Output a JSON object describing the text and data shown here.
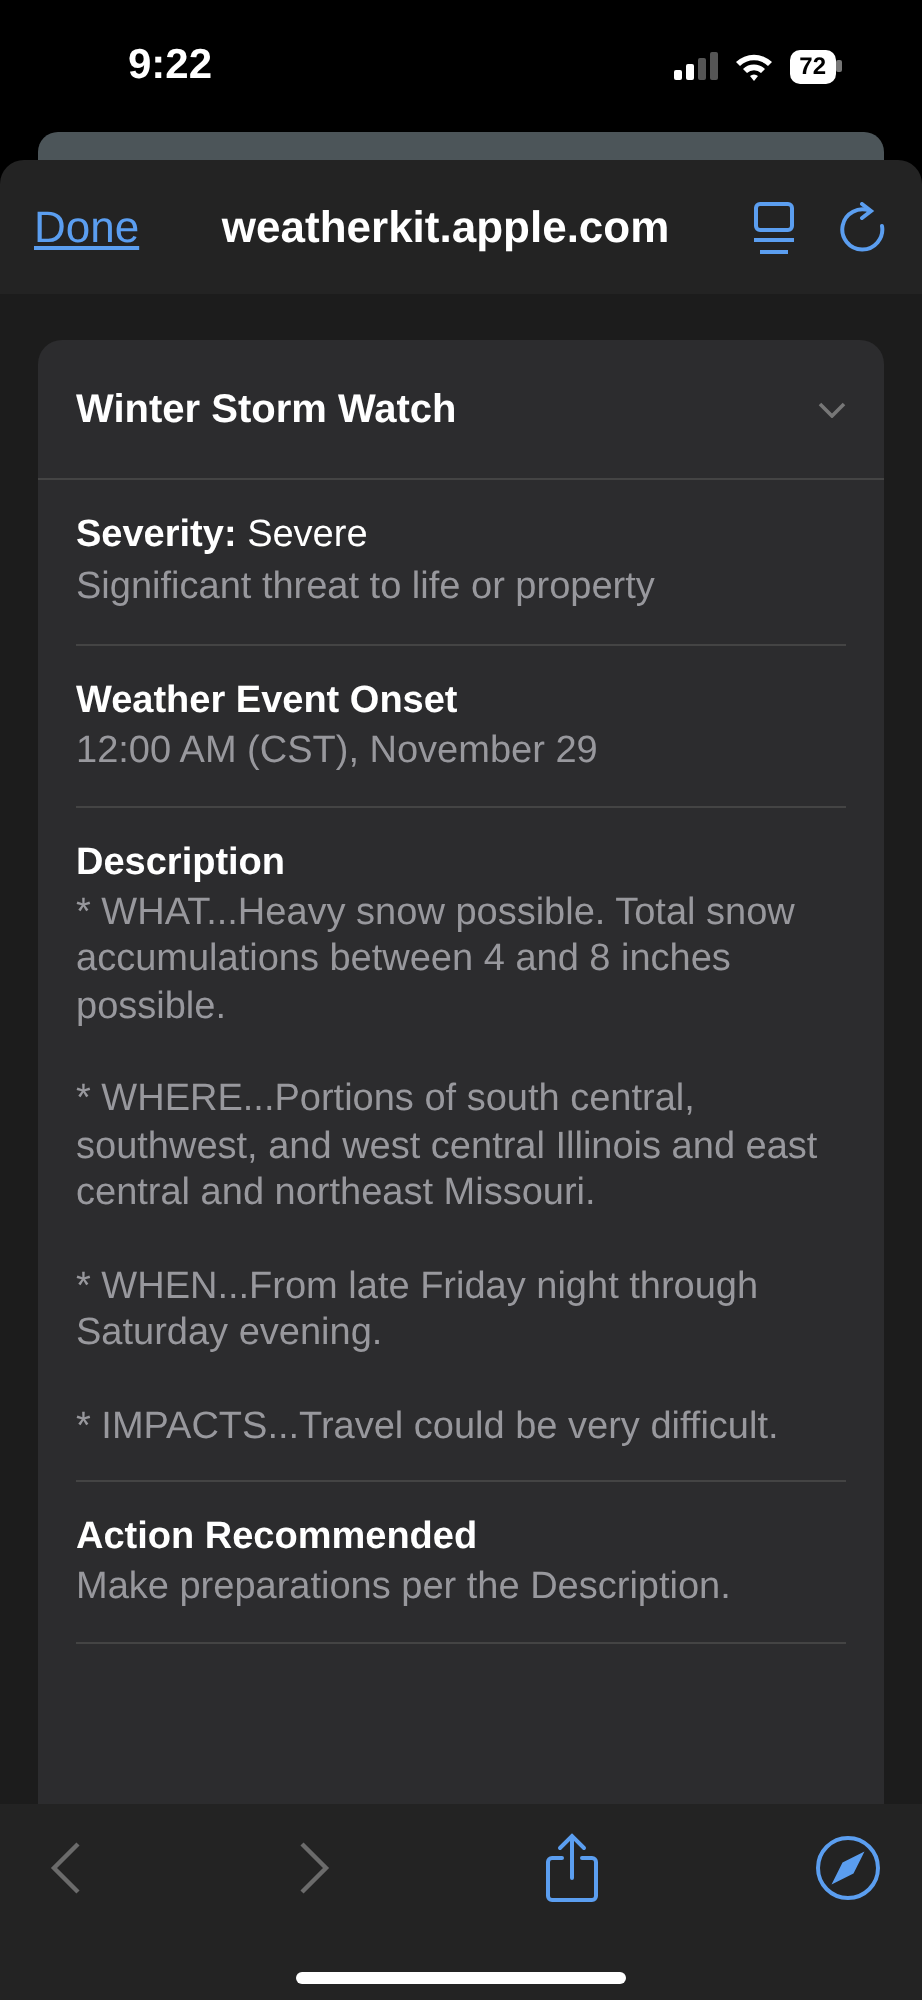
{
  "status_bar": {
    "time": "9:22",
    "battery": "72"
  },
  "nav_bar": {
    "done": "Done",
    "url": "weatherkit.apple.com"
  },
  "alert": {
    "title": "Winter Storm Watch",
    "expanded": true,
    "sections": [
      {
        "kind": "severity",
        "label": "Severity:",
        "value": "Severe",
        "detail": "Significant threat to life or property"
      },
      {
        "kind": "field",
        "label": "Weather Event Onset",
        "paragraphs": [
          "12:00 AM (CST), November 29"
        ]
      },
      {
        "kind": "field",
        "label": "Description",
        "paragraphs": [
          "* WHAT...Heavy snow possible. Total snow accumulations between 4 and 8 inches possible.",
          "* WHERE...Portions of south central, southwest, and west central Illinois and east central and northeast Missouri.",
          "* WHEN...From late Friday night through Saturday evening.",
          "* IMPACTS...Travel could be very difficult."
        ]
      },
      {
        "kind": "field",
        "label": "Action Recommended",
        "paragraphs": [
          "Make preparations per the Description."
        ]
      }
    ]
  },
  "toolbar": {
    "back_disabled": true,
    "forward_disabled": true
  }
}
